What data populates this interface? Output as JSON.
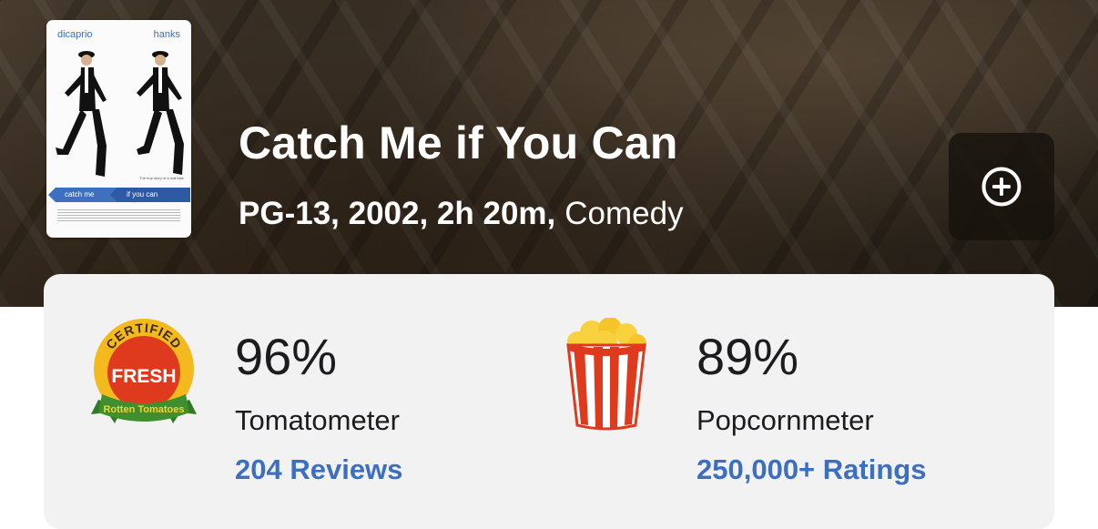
{
  "poster": {
    "actor_left": "dicaprio",
    "actor_right": "hanks",
    "arrow_left": "catch me",
    "arrow_right": "if you can"
  },
  "movie": {
    "title": "Catch Me if You Can",
    "meta": "PG-13, 2002, 2h 20m,",
    "genre": "Comedy"
  },
  "actions": {
    "add_icon": "plus-circle-icon"
  },
  "scores": {
    "tomatometer": {
      "badge_icon": "certified-fresh-icon",
      "badge_top": "CERTIFIED",
      "badge_middle": "FRESH",
      "badge_bottom": "Rotten Tomatoes",
      "value": "96%",
      "label": "Tomatometer",
      "count": "204 Reviews"
    },
    "popcornmeter": {
      "badge_icon": "popcorn-bucket-icon",
      "value": "89%",
      "label": "Popcornmeter",
      "count": "250,000+ Ratings"
    }
  },
  "colors": {
    "link": "#3d6fc1",
    "fresh_red": "#e03a1e",
    "badge_green": "#3f8f2e",
    "badge_gold": "#f4b91d",
    "card_bg": "#f2f2f3"
  }
}
